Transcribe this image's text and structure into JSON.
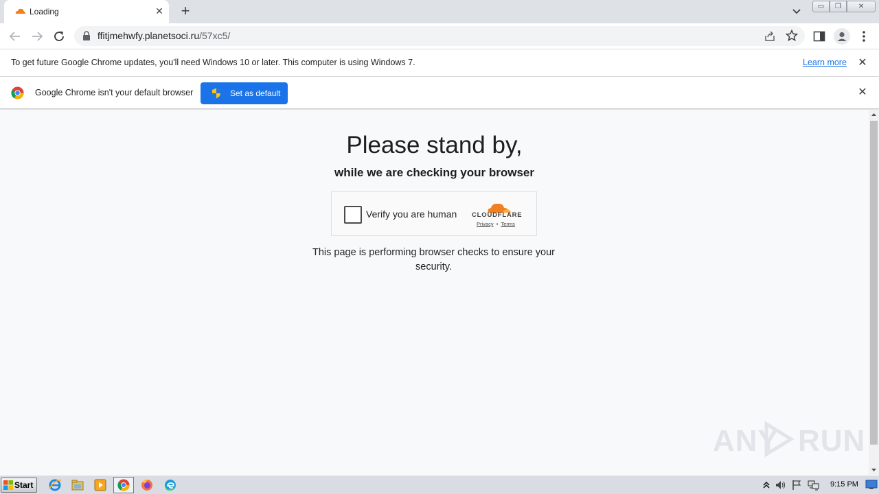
{
  "tab": {
    "title": "Loading",
    "close": "✕",
    "new_tab": "+"
  },
  "window_controls": {
    "minimize": "▭",
    "maximize": "❐",
    "close": "✕"
  },
  "omnibox": {
    "host": "ffitjmehwfy.planetsoci.ru",
    "path": "/57xc5/"
  },
  "update_bar": {
    "message": "To get future Google Chrome updates, you'll need Windows 10 or later. This computer is using Windows 7.",
    "link": "Learn more",
    "close": "✕"
  },
  "default_bar": {
    "message": "Google Chrome isn't your default browser",
    "button": "Set as default",
    "close": "✕"
  },
  "page": {
    "heading": "Please stand by,",
    "subheading": "while we are checking your browser",
    "challenge": {
      "label": "Verify you are human",
      "brand": "CLOUDFLARE",
      "privacy": "Privacy",
      "separator": "•",
      "terms": "Terms"
    },
    "checks_text": "This page is performing browser checks to ensure your security."
  },
  "watermark": {
    "left": "ANY",
    "right": "RUN"
  },
  "taskbar": {
    "start": "Start",
    "clock": "9:15 PM"
  },
  "colors": {
    "accent": "#1a73e8",
    "cloudflare_orange": "#f38020",
    "page_bg": "#f8f9fb"
  }
}
